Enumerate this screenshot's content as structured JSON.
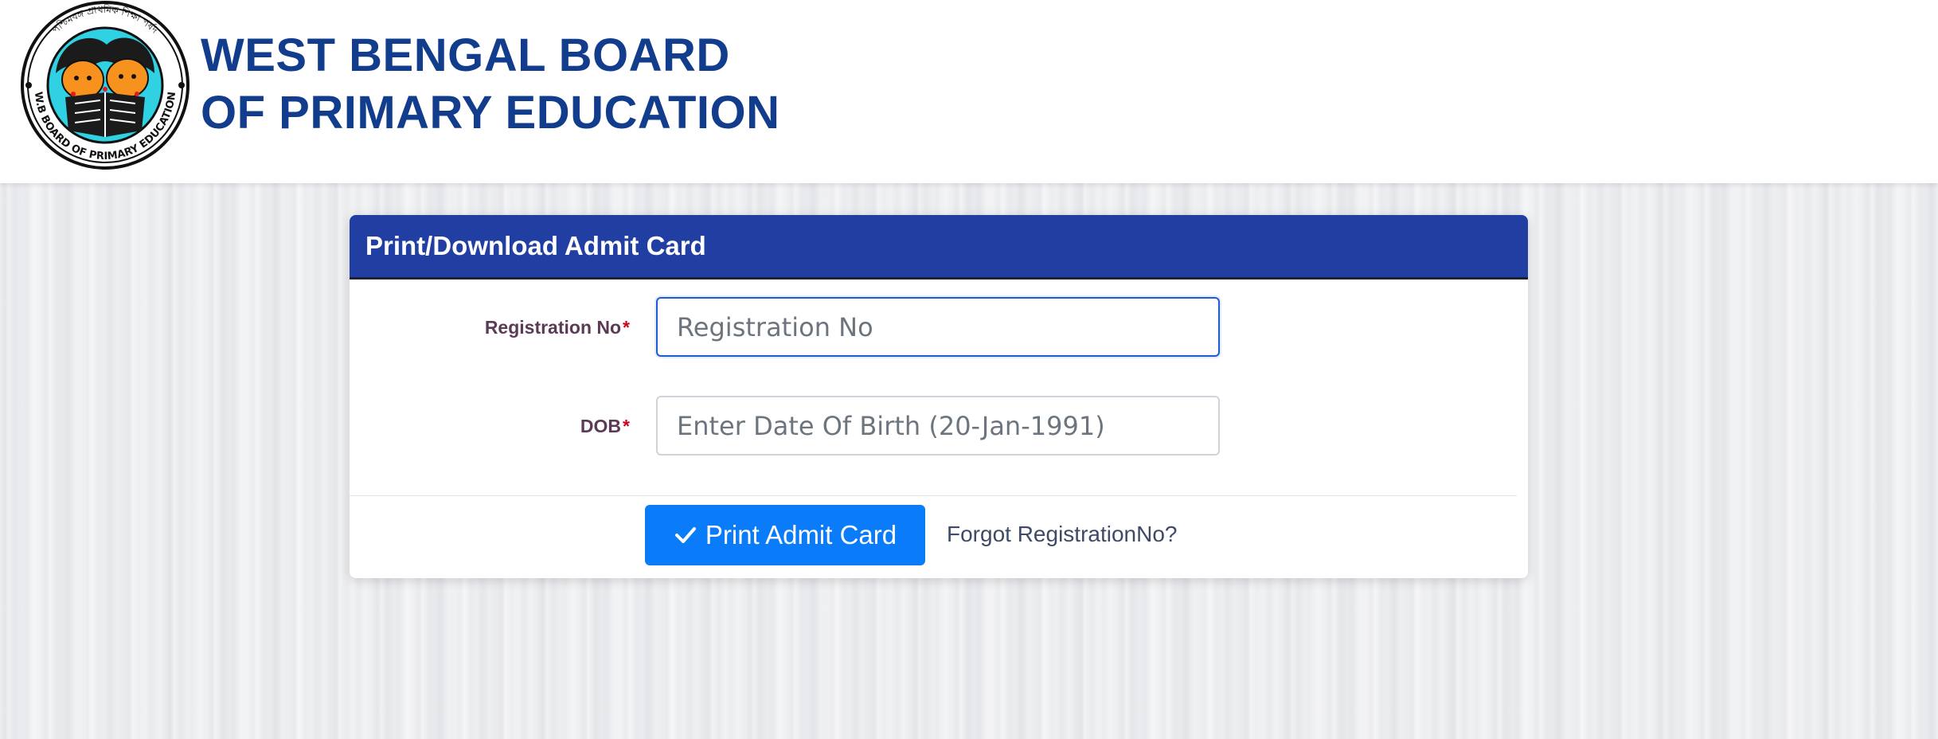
{
  "header": {
    "title_line1": "WEST BENGAL BOARD",
    "title_line2": "OF PRIMARY EDUCATION",
    "logo_icon": "wbbpe-emblem-logo",
    "logo_text_bottom": "W.B BOARD OF PRIMARY EDUCATION",
    "logo_text_top": "পশ্চিমবঙ্গ প্রাথমিক শিক্ষা পর্ষদ"
  },
  "card": {
    "title": "Print/Download Admit Card"
  },
  "form": {
    "registration_label": "Registration No",
    "registration_required": "*",
    "registration_value": "",
    "registration_placeholder": "Registration No",
    "dob_label": "DOB",
    "dob_required": "*",
    "dob_value": "",
    "dob_placeholder": "Enter Date Of Birth (20-Jan-1991)"
  },
  "actions": {
    "print_label": "Print Admit Card",
    "print_icon": "check-icon",
    "forgot_label": "Forgot RegistrationNo?"
  },
  "colors": {
    "title_blue": "#123c8c",
    "card_header": "#213fa3",
    "button_blue": "#0b7cf9",
    "required_red": "#d0021b",
    "label_color": "#5b3a55"
  }
}
